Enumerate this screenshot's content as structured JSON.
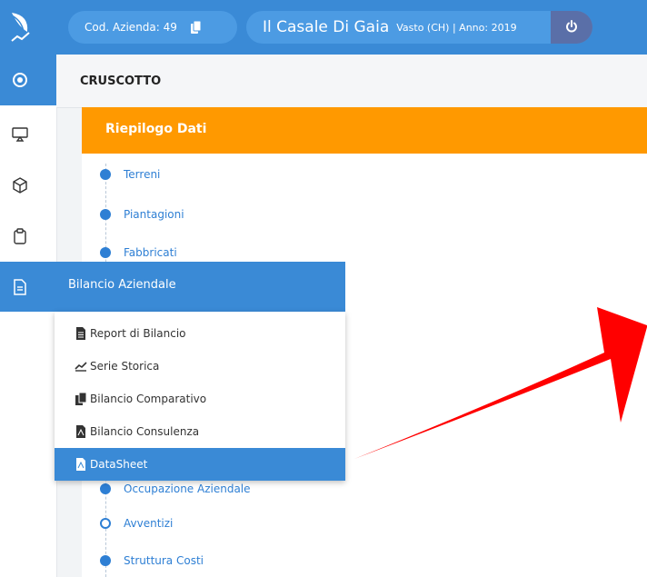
{
  "header": {
    "cod_label": "Cod. Azienda: 49",
    "company_name": "Il Casale Di Gaia",
    "company_sub": "Vasto (CH) | Anno: 2019",
    "logo_icon": "leaf-logo-icon",
    "copy_icon": "copy-icon",
    "power_icon": "power-icon"
  },
  "sidebar": {
    "icons": [
      "dashboard-icon",
      "monitor-icon",
      "box-icon",
      "clipboard-icon",
      "document-icon"
    ]
  },
  "page": {
    "title": "CRUSCOTTO"
  },
  "card": {
    "title": "Riepilogo Dati",
    "accent": "#ff9900"
  },
  "timeline": {
    "items": [
      {
        "label": "Terreni"
      },
      {
        "label": "Piantagioni"
      },
      {
        "label": "Fabbricati"
      },
      {
        "label": "Occupazione Aziendale"
      },
      {
        "label": "Avventizi"
      },
      {
        "label": "Struttura Costi"
      }
    ]
  },
  "flyout": {
    "title": "Bilancio Aziendale",
    "items": [
      {
        "label": "Report di Bilancio",
        "icon": "report-icon"
      },
      {
        "label": "Serie Storica",
        "icon": "chart-line-icon"
      },
      {
        "label": "Bilancio Comparativo",
        "icon": "files-icon"
      },
      {
        "label": "Bilancio Consulenza",
        "icon": "pdf-file-icon"
      },
      {
        "label": "DataSheet",
        "icon": "pdf-file-icon"
      }
    ]
  },
  "colors": {
    "primary": "#3a8ad6",
    "highlight_arrow": "#ff0000"
  }
}
